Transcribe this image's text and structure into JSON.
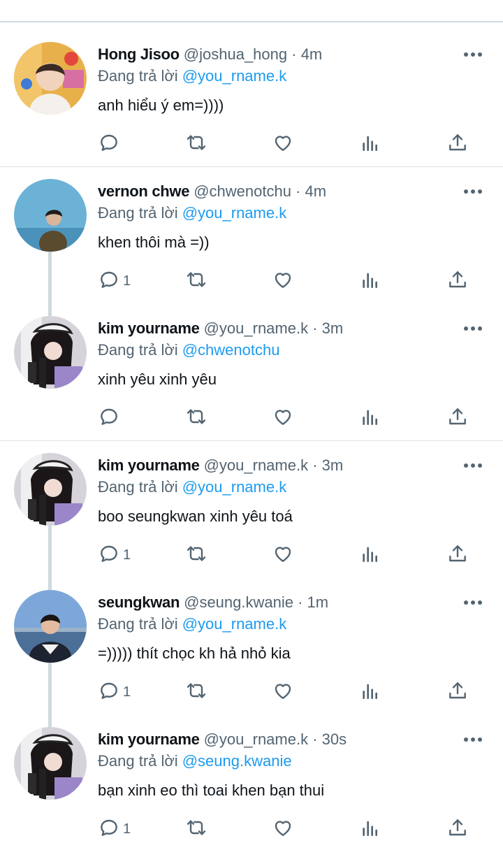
{
  "reply_prefix": "Đang trả lời",
  "tweets": [
    {
      "name": "Hong Jisoo",
      "handle": "@joshua_hong",
      "time": "4m",
      "reply_to": "@you_rname.k",
      "text": "anh hiểu ý em=))))",
      "reply_count": "",
      "avatar": "hong-jisoo-avatar"
    },
    {
      "name": "vernon chwe",
      "handle": "@chwenotchu",
      "time": "4m",
      "reply_to": "@you_rname.k",
      "text": "khen thôi mà =))",
      "reply_count": "1",
      "avatar": "vernon-chwe-avatar"
    },
    {
      "name": "kim yourname",
      "handle": "@you_rname.k",
      "time": "3m",
      "reply_to": "@chwenotchu",
      "text": "xinh yêu xinh yêu",
      "reply_count": "",
      "avatar": "kim-yourname-avatar"
    },
    {
      "name": "kim yourname",
      "handle": "@you_rname.k",
      "time": "3m",
      "reply_to": "@you_rname.k",
      "text": "boo seungkwan xinh yêu toá",
      "reply_count": "1",
      "avatar": "kim-yourname-avatar"
    },
    {
      "name": "seungkwan",
      "handle": "@seung.kwanie",
      "time": "1m",
      "reply_to": "@you_rname.k",
      "text": "=))))) thít chọc kh hả nhỏ kia",
      "reply_count": "1",
      "avatar": "seungkwan-avatar"
    },
    {
      "name": "kim yourname",
      "handle": "@you_rname.k",
      "time": "30s",
      "reply_to": "@seung.kwanie",
      "text": "bạn xinh eo thì toai khen bạn thui",
      "reply_count": "1",
      "avatar": "kim-yourname-avatar"
    }
  ],
  "colors": {
    "link": "#1d9bf0",
    "secondary_text": "#536471",
    "icon": "#536471",
    "divider": "#cfd9de"
  }
}
